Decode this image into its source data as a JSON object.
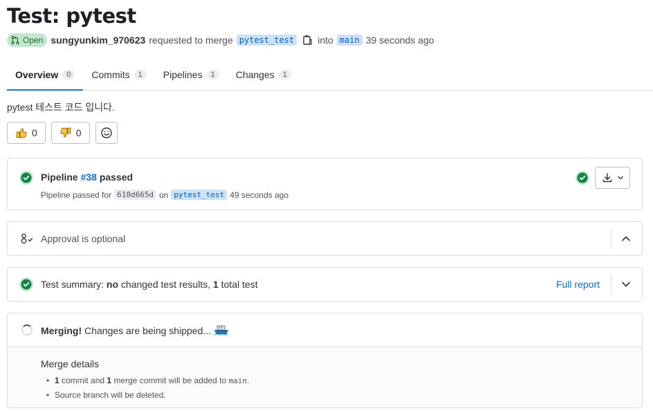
{
  "page_title": "Test: pytest",
  "meta": {
    "status": "Open",
    "author": "sungyunkim_970623",
    "requested_text": "requested to merge",
    "source_branch": "pytest_test",
    "into_text": "into",
    "target_branch": "main",
    "time_ago": "39 seconds ago"
  },
  "tabs": [
    {
      "label": "Overview",
      "count": "0"
    },
    {
      "label": "Commits",
      "count": "1"
    },
    {
      "label": "Pipelines",
      "count": "1"
    },
    {
      "label": "Changes",
      "count": "1"
    }
  ],
  "description": "pytest 테스트 코드 입니다.",
  "reactions": {
    "thumbs_up": "0",
    "thumbs_down": "0"
  },
  "pipeline": {
    "prefix": "Pipeline",
    "number": "#38",
    "status": "passed",
    "sub_prefix": "Pipeline passed for",
    "commit_sha": "610d665d",
    "on_text": "on",
    "branch": "pytest_test",
    "time_ago": "49 seconds ago"
  },
  "approval": {
    "text": "Approval is optional"
  },
  "test_summary": {
    "prefix": "Test summary:",
    "bold1": "no",
    "mid": "changed test results,",
    "bold2": "1",
    "suffix": "total test",
    "report_link": "Full report"
  },
  "merge": {
    "bold": "Merging!",
    "text": "Changes are being shipped...",
    "details_title": "Merge details",
    "item1": {
      "n1": "1",
      "t1": "commit and",
      "n2": "1",
      "t2": "merge commit will be added to",
      "branch": "main",
      "end": "."
    },
    "item2": "Source branch will be deleted."
  },
  "colors": {
    "success": "#108548",
    "link": "#1068bf",
    "open_badge_bg": "#c3e6cd",
    "branch_chip_bg": "#cbe2f9"
  },
  "icons": [
    "merge-request-icon",
    "copy-icon",
    "thumbs-up-icon",
    "thumbs-down-icon",
    "smiley-icon",
    "check-circle-icon",
    "download-icon",
    "chevron-down-icon",
    "approval-icon",
    "chevron-up-icon",
    "spinner-icon",
    "ship-icon"
  ]
}
